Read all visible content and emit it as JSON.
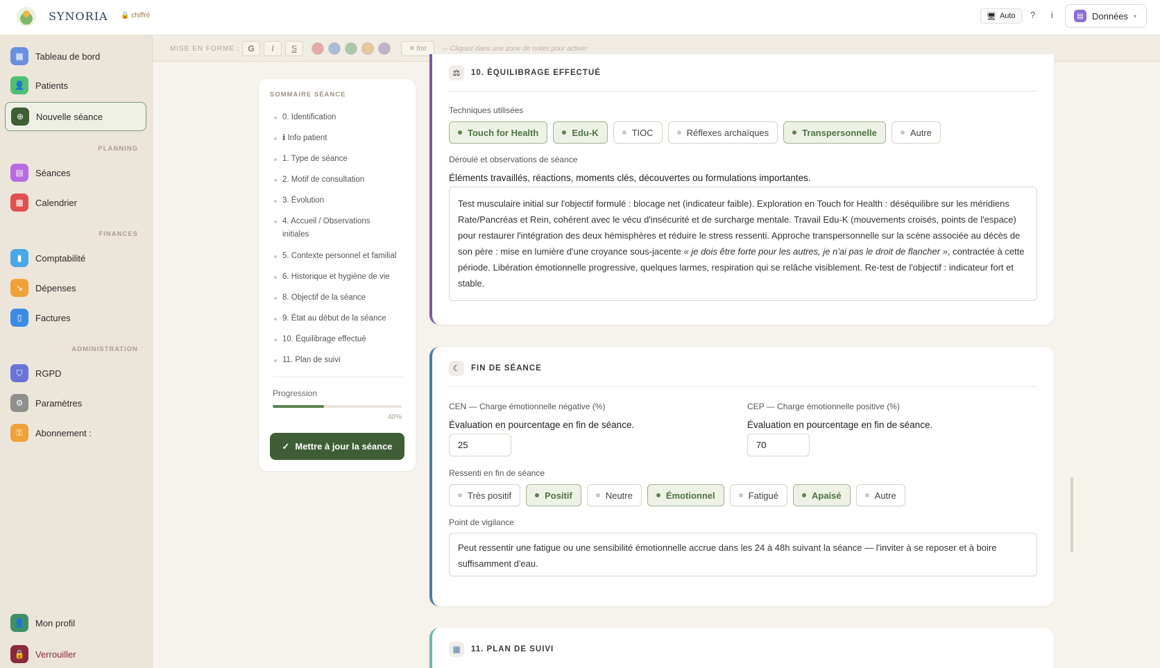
{
  "app": {
    "brand": "SYNORIA",
    "encryption": "chiffré"
  },
  "topbar": {
    "auto_label": "Auto",
    "help": "?",
    "info": "i",
    "data_label": "Données"
  },
  "sidebar": {
    "items": [
      {
        "label": "Tableau de bord"
      },
      {
        "label": "Patients"
      },
      {
        "label": "Nouvelle séance"
      },
      {
        "label": "Séances"
      },
      {
        "label": "Calendrier"
      },
      {
        "label": "Comptabilité"
      },
      {
        "label": "Dépenses"
      },
      {
        "label": "Factures"
      },
      {
        "label": "RGPD"
      },
      {
        "label": "Paramètres"
      },
      {
        "label": "Abonnement :"
      },
      {
        "label": "Mon profil"
      },
      {
        "label": "Verrouiller"
      }
    ],
    "sections": {
      "planning": "PLANNING",
      "finances": "FINANCES",
      "admin": "ADMINISTRATION"
    }
  },
  "format_bar": {
    "label": "MISE EN FORME :",
    "bold": "G",
    "italic": "I",
    "strike": "S",
    "colors": [
      "#e6a9a9",
      "#a9bcd9",
      "#a9c9a8",
      "#e8c79a",
      "#c1b3cf"
    ],
    "clear_label": "✕ fmt",
    "hint": "— Cliquez dans une zone de notes pour activer"
  },
  "summary": {
    "title": "SOMMAIRE SÉANCE",
    "items": [
      "0. Identification",
      "ℹ Info patient",
      "1. Type de séance",
      "2. Motif de consultation",
      "3. Évolution",
      "4. Accueil / Observations initiales",
      "5. Contexte personnel et familial",
      "6. Historique et hygiène de vie",
      "8. Objectif de la séance",
      "9. État au début de la séance",
      "10. Équilibrage effectué",
      "11. Plan de suivi"
    ],
    "progress_label": "Progression",
    "progress_value": 0.4,
    "progress_pct": "40%",
    "update_button": "Mettre à jour la séance"
  },
  "equilibrage": {
    "title": "10. ÉQUILIBRAGE EFFECTUÉ",
    "techniques_label": "Techniques utilisées",
    "techniques": [
      {
        "label": "Touch for Health",
        "selected": true
      },
      {
        "label": "Edu-K",
        "selected": true
      },
      {
        "label": "TIOC",
        "selected": false
      },
      {
        "label": "Réflexes archaïques",
        "selected": false
      },
      {
        "label": "Transpersonnelle",
        "selected": true
      },
      {
        "label": "Autre",
        "selected": false
      }
    ],
    "observations_label": "Déroulé et observations de séance",
    "observations_desc": "Éléments travaillés, réactions, moments clés, découvertes ou formulations importantes.",
    "observations_text_a": "Test musculaire initial sur l'objectif formulé : blocage net (indicateur faible). Exploration en Touch for Health : déséquilibre sur les méridiens Rate/Pancréas et Rein, cohérent avec le vécu d'insécurité et de surcharge mentale. Travail Edu-K (mouvements croisés, points de l'espace) pour restaurer l'intégration des deux hémisphères et réduire le stress ressenti. Approche transpersonnelle sur la scène associée au décès de son père : mise en lumière d'une croyance sous-jacente ",
    "observations_text_italic": "« je dois être forte pour les autres, je n'ai pas le droit de flancher »",
    "observations_text_b": ", contractée à cette période. Libération émotionnelle progressive, quelques larmes, respiration qui se relâche visiblement. Re-test de l'objectif : indicateur fort et stable."
  },
  "fin_seance": {
    "title": "FIN DE SÉANCE",
    "cen_label": "CEN — Charge émotionnelle négative (%)",
    "cen_desc": "Évaluation en pourcentage en fin de séance.",
    "cen_value": "25",
    "cep_label": "CEP — Charge émotionnelle positive (%)",
    "cep_desc": "Évaluation en pourcentage en fin de séance.",
    "cep_value": "70",
    "ressenti_label": "Ressenti en fin de séance",
    "ressenti": [
      {
        "label": "Très positif",
        "selected": false
      },
      {
        "label": "Positif",
        "selected": true
      },
      {
        "label": "Neutre",
        "selected": false
      },
      {
        "label": "Émotionnel",
        "selected": true
      },
      {
        "label": "Fatigué",
        "selected": false
      },
      {
        "label": "Apaisé",
        "selected": true
      },
      {
        "label": "Autre",
        "selected": false
      }
    ],
    "vigilance_label": "Point de vigilance",
    "vigilance_text": "Peut ressentir une fatigue ou une sensibilité émotionnelle accrue dans les 24 à 48h suivant la séance — l'inviter à se reposer et à boire suffisamment d'eau."
  },
  "plan_suivi": {
    "title": "11. PLAN DE SUIVI"
  }
}
